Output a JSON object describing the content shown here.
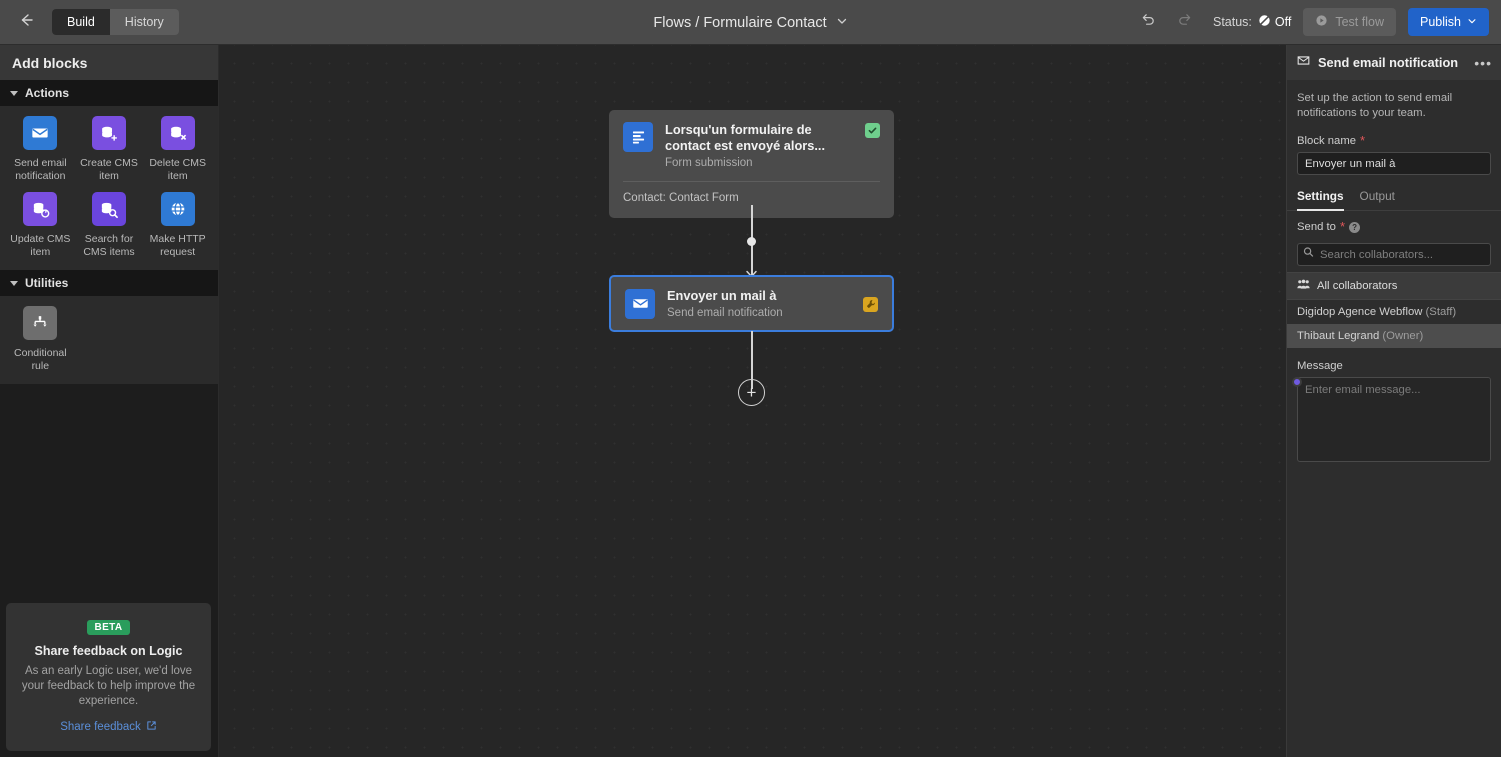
{
  "topbar": {
    "back_icon": "arrow-left-icon",
    "segments": [
      {
        "label": "Build",
        "active": true
      },
      {
        "label": "History",
        "active": false
      }
    ],
    "flow_title": "Flows / Formulaire Contact",
    "undo_icon": "undo-icon",
    "redo_icon": "redo-icon",
    "status_label": "Status:",
    "status_value": "Off",
    "status_icon": "no-entry-icon",
    "test_flow_label": "Test flow",
    "test_flow_icon": "play-circle-icon",
    "publish_label": "Publish",
    "publish_caret": "chevron-down-icon",
    "publish_color": "#2163c9"
  },
  "sidebar": {
    "header": "Add blocks",
    "sections": [
      {
        "title": "Actions",
        "blocks": [
          {
            "label": "Send email notification",
            "icon": "envelope-icon",
            "color": "#2f7ad4"
          },
          {
            "label": "Create CMS item",
            "icon": "database-plus-icon",
            "color": "#7a4fe0"
          },
          {
            "label": "Delete CMS item",
            "icon": "database-x-icon",
            "color": "#7a4fe0"
          },
          {
            "label": "Update CMS item",
            "icon": "database-refresh-icon",
            "color": "#7a4fe0"
          },
          {
            "label": "Search for CMS items",
            "icon": "database-search-icon",
            "color": "#6a45dd"
          },
          {
            "label": "Make HTTP request",
            "icon": "globe-icon",
            "color": "#2f7ad4"
          }
        ]
      },
      {
        "title": "Utilities",
        "blocks": [
          {
            "label": "Conditional rule",
            "icon": "branch-icon",
            "color": "#6e6e6e"
          }
        ]
      }
    ],
    "feedback": {
      "badge": "BETA",
      "badge_color": "#2a9d5c",
      "title": "Share feedback on Logic",
      "text": "As an early Logic user, we'd love your feedback to help improve the experience.",
      "link": "Share feedback",
      "link_icon": "external-link-icon"
    }
  },
  "canvas": {
    "trigger_node": {
      "icon": "form-icon",
      "title": "Lorsqu'un formulaire de contact est envoyé alors...",
      "subtitle": "Form submission",
      "meta": "Contact: Contact Form",
      "badge_icon": "check-icon",
      "badge_color": "#6fcf8d"
    },
    "action_node": {
      "icon": "envelope-icon",
      "title": "Envoyer un mail à",
      "subtitle": "Send email notification",
      "badge_icon": "wrench-icon",
      "badge_color": "#d9a520",
      "selected_outline": "#3b7ddd"
    },
    "add_step_label": "+"
  },
  "right_panel": {
    "header_icon": "envelope-icon",
    "header_title": "Send email notification",
    "more_icon": "ellipsis-icon",
    "description": "Set up the action to send email notifications to your team.",
    "block_name_label": "Block name",
    "block_name_value": "Envoyer un mail à",
    "tabs": [
      {
        "label": "Settings",
        "active": true
      },
      {
        "label": "Output",
        "active": false
      }
    ],
    "send_to_label": "Send to",
    "send_to_help_icon": "question-circle-icon",
    "search_placeholder": "Search collaborators...",
    "search_icon": "search-icon",
    "all_collaborators_label": "All collaborators",
    "all_collaborators_icon": "people-icon",
    "collaborators": [
      {
        "name": "Digidop Agence Webflow",
        "role": "(Staff)",
        "highlighted": false
      },
      {
        "name": "Thibaut Legrand",
        "role": "(Owner)",
        "highlighted": true
      }
    ],
    "message_label": "Message",
    "message_placeholder": "Enter email message...",
    "message_value": ""
  }
}
